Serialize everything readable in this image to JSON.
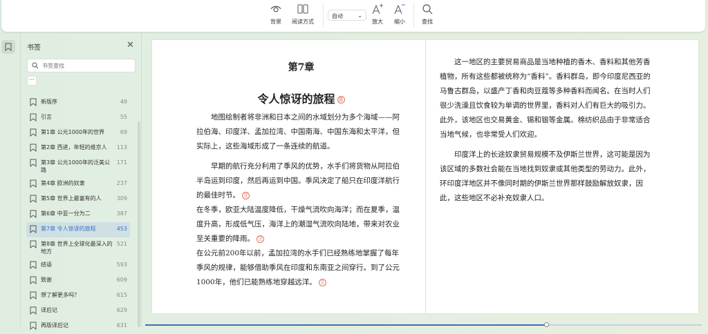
{
  "toolbar": {
    "background": "背景",
    "read_mode": "阅读方式",
    "zoom_select": "自动",
    "zoom_in": "放大",
    "zoom_out": "缩小",
    "find": "查找"
  },
  "sidebar": {
    "title": "书签",
    "search_placeholder": "书签查找",
    "more": "···",
    "items": [
      {
        "label": "新版序",
        "page": "49"
      },
      {
        "label": "引言",
        "page": "55"
      },
      {
        "label": "第1章 公元1000年的世界",
        "page": "69"
      },
      {
        "label": "第2章 西进，年轻的维京人",
        "page": "113"
      },
      {
        "label": "第3章 公元1000年的泛美公路",
        "page": "171"
      },
      {
        "label": "第4章 欧洲的奴隶",
        "page": "237"
      },
      {
        "label": "第5章 世界上最富有的人",
        "page": "309"
      },
      {
        "label": "第6章 中亚一分为二",
        "page": "387"
      },
      {
        "label": "第7章 令人惊讶的旅程",
        "page": "453"
      },
      {
        "label": "第8章 世界上全球化最深入的地方",
        "page": "521"
      },
      {
        "label": "结语",
        "page": "593"
      },
      {
        "label": "致谢",
        "page": "609"
      },
      {
        "label": "想了解更多吗？",
        "page": "615"
      },
      {
        "label": "译后记",
        "page": "629"
      },
      {
        "label": "再版译后记",
        "page": "631"
      }
    ]
  },
  "left_page": {
    "chapter": "第7章",
    "title": "令人惊讶的旅程",
    "note": "注",
    "paras": [
      "地图绘制者将非洲和日本之间的水域划分为多个海域——阿拉伯海、印度洋、孟加拉湾、中国南海、中国东海和太平洋，但实际上，这些海域形成了一条连续的航道。",
      "早期的航行充分利用了季风的优势，水手们将货物从阿拉伯半岛运到印度，然后再运到中国。季风决定了船只在印度洋航行的最佳时节。",
      "在冬季，欧亚大陆温度降低，干燥气流吹向海洋；而在夏季，温度升高，形成低气压，海洋上的潮湿气流吹向陆地，带来对农业至关重要的降雨。",
      "在公元前200年以前，孟加拉湾的水手们已经熟练地掌握了每年季风的规律，能够借助季风在印度和东南亚之间穿行。到了公元1000年，他们已能熟练地穿越远洋。"
    ]
  },
  "right_page": {
    "paras": [
      "这一地区的主要贸易商品是当地种植的香木、香料和其他芳香植物，所有这些都被统称为“香料”。香料群岛，即今印度尼西亚的马鲁古群岛，以盛产丁香和肉豆蔻等多种香料而闻名。在当时人们很少洗澡且饮食较为单调的世界里，香料对人们有巨大的吸引力。此外，该地区也交易黄金、锡和银等金属。棉纺织品由于非常适合当地气候，也非常受人们欢迎。",
      "印度洋上的长途奴隶贸易规模不及伊斯兰世界，这可能是因为该区域的多数社会能在当地找到奴隶或其他类型的劳动力。此外，环印度洋地区并不像同时期的伊斯兰世界那样鼓励解放奴隶，因此，这些地区不必补充奴隶人口。"
    ]
  },
  "progress": 0.72,
  "colors": {
    "accent": "#3b6fd1",
    "note": "#e07060"
  }
}
